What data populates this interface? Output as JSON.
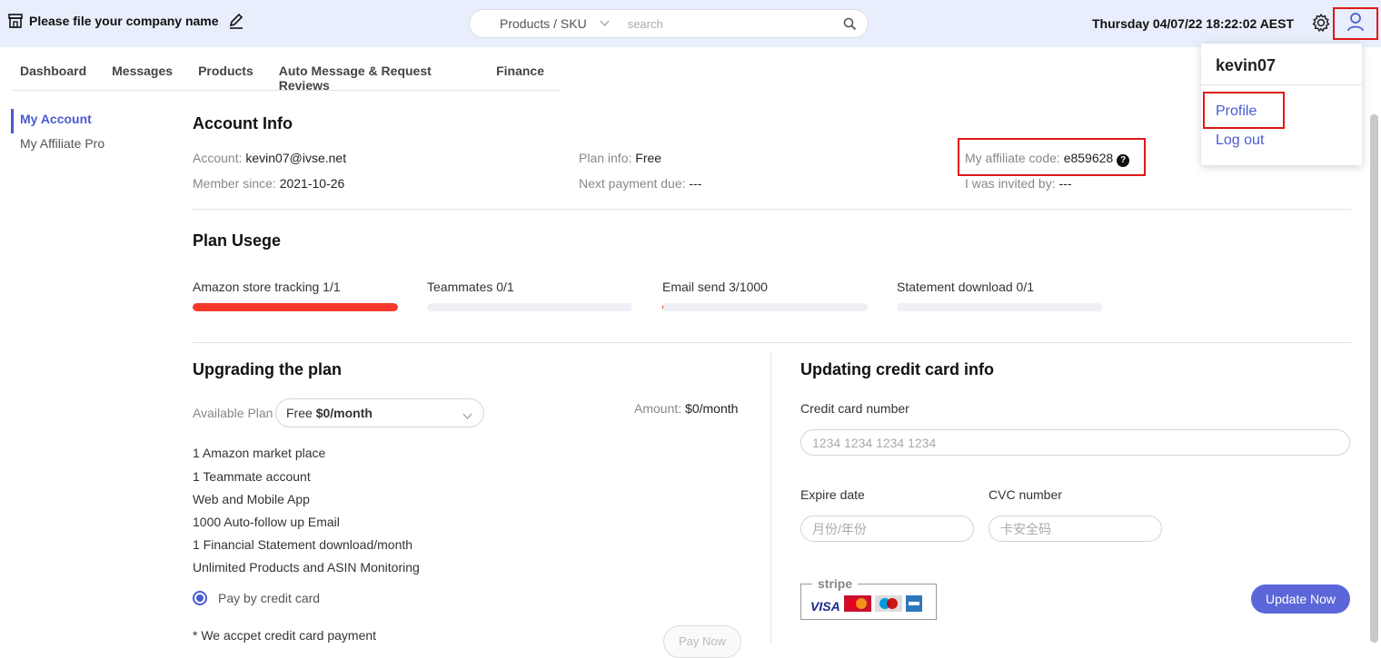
{
  "header": {
    "company_name": "Please file your company name",
    "search_select": "Products / SKU",
    "search_placeholder": "search",
    "datetime": "Thursday 04/07/22 18:22:02 AEST"
  },
  "nav": {
    "tabs": [
      "Dashboard",
      "Messages",
      "Products",
      "Auto Message & Request Reviews",
      "Finance"
    ]
  },
  "sidebar": {
    "items": [
      "My Account",
      "My Affiliate Pro"
    ],
    "active": "My Account"
  },
  "account_info": {
    "title": "Account Info",
    "account_label": "Account:",
    "account": "kevin07@ivse.net",
    "member_since_label": "Member since:",
    "member_since": "2021-10-26",
    "plan_label": "Plan info:",
    "plan": "Free",
    "next_payment_label": "Next payment due:",
    "next_payment": "---",
    "affiliate_label": "My affiliate code:",
    "affiliate_code": "e859628",
    "help_glyph": "?",
    "invited_label": "I was invited by:",
    "invited_by": "---"
  },
  "plan_usage": {
    "title": "Plan Usege",
    "items": [
      {
        "label": "Amazon store tracking 1/1",
        "fraction": 1.0
      },
      {
        "label": "Teammates 0/1",
        "fraction": 0
      },
      {
        "label": "Email send 3/1000",
        "fraction": 0.003
      },
      {
        "label": "Statement download 0/1",
        "fraction": 0
      }
    ],
    "fill_color": "#f5392b"
  },
  "upgrade": {
    "title": "Upgrading the plan",
    "available_label": "Available Plan",
    "plan_name": "Free",
    "plan_price": "$0/month",
    "amount_label": "Amount:",
    "amount": "$0/month",
    "features": [
      "1 Amazon market place",
      "1 Teammate account",
      "Web and Mobile App",
      "1000 Auto-follow up Email",
      "1 Financial Statement download/month",
      "Unlimited Products and ASIN Monitoring"
    ],
    "pay_method": "Pay by credit card",
    "note": "* We accpet credit card payment",
    "pay_button": "Pay Now"
  },
  "credit_card": {
    "title": "Updating credit card info",
    "number_label": "Credit card number",
    "number_placeholder": "1234 1234 1234 1234",
    "expire_label": "Expire date",
    "expire_placeholder": "月份/年份",
    "cvc_label": "CVC number",
    "cvc_placeholder": "卡安全码",
    "stripe_word": "stripe",
    "visa": "VISA",
    "update_button": "Update Now"
  },
  "user_menu": {
    "username": "kevin07",
    "options": [
      "Profile",
      "Log out"
    ]
  },
  "colors": {
    "accent": "#5b67d8",
    "header_bg": "#e8eefb",
    "highlight": "#e01818"
  }
}
